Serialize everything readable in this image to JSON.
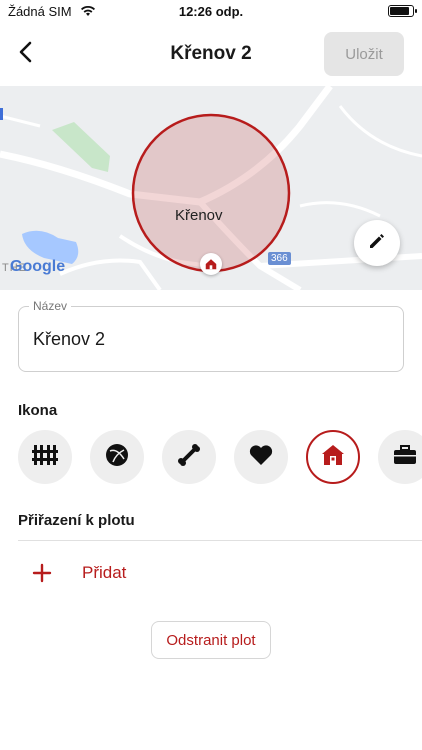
{
  "status_bar": {
    "carrier": "Žádná SIM",
    "time": "12:26 odp."
  },
  "header": {
    "back_icon": "chevron-left-icon",
    "title": "Křenov 2",
    "save_label": "Uložit"
  },
  "map": {
    "place_label": "Křenov",
    "road_number": "366",
    "google_label": "Google",
    "partial_label": "THE",
    "fence_color": "#b71c1c",
    "edit_icon": "pencil-icon"
  },
  "name_field": {
    "label": "Název",
    "value": "Křenov 2"
  },
  "icon_section": {
    "label": "Ikona",
    "options": [
      {
        "icon": "fence-icon",
        "selected": false
      },
      {
        "icon": "ball-icon",
        "selected": false
      },
      {
        "icon": "bone-icon",
        "selected": false
      },
      {
        "icon": "heart-icon",
        "selected": false
      },
      {
        "icon": "house-icon",
        "selected": true
      },
      {
        "icon": "briefcase-icon",
        "selected": false
      }
    ]
  },
  "assignment_section": {
    "label": "Přiřazení k plotu",
    "add_label": "Přidat",
    "add_icon": "plus-icon"
  },
  "remove_label": "Odstranit plot",
  "colors": {
    "accent": "#b71c1c",
    "disabled_button_bg": "#e5e5e5",
    "icon_bg": "#eeeeee"
  }
}
